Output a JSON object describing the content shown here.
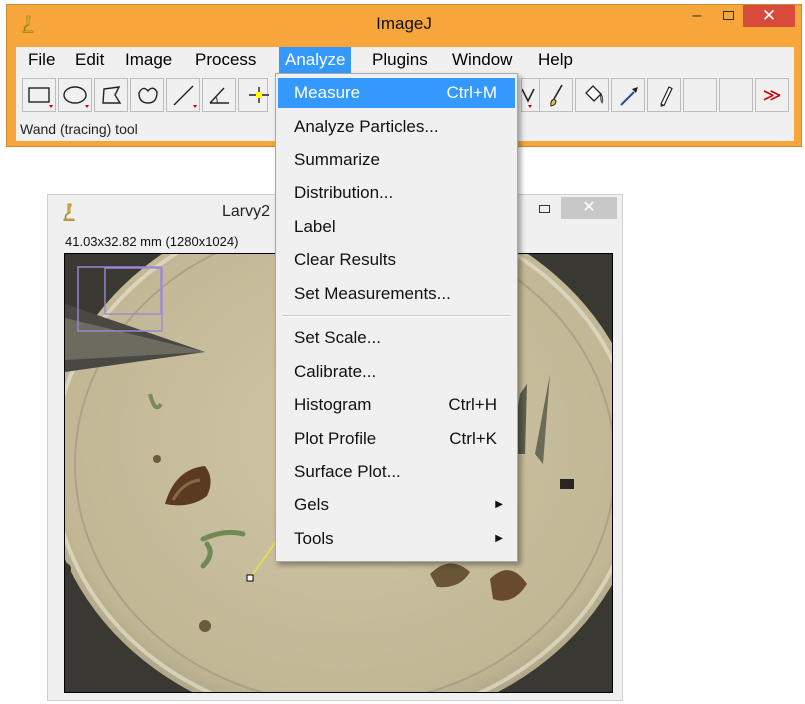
{
  "main_window": {
    "title": "ImageJ",
    "minimize_glyph": "–",
    "close_glyph": "✕",
    "menu": [
      "File",
      "Edit",
      "Image",
      "Process",
      "Analyze",
      "Plugins",
      "Window",
      "Help"
    ],
    "active_menu": "Analyze",
    "status_text": "Wand (tracing) tool",
    "toolbar_icons": [
      "rectangle-tool-icon",
      "oval-tool-icon",
      "polygon-tool-icon",
      "freehand-tool-icon",
      "line-tool-icon",
      "angle-tool-icon",
      "point-tool-icon",
      "wand-tool-icon",
      "brush-tool-icon",
      "flood-fill-tool-icon",
      "color-picker-icon",
      "pencil-tool-icon",
      "more-tools-icon"
    ],
    "more_tools_glyph": "≫",
    "accent_color": "#3399ff",
    "title_bar_color": "#f6a63a",
    "close_color": "#d74a3c"
  },
  "image_window": {
    "title": "Larvy2",
    "info": "41.03x32.82 mm (1280x1024)",
    "close_glyph": "✕"
  },
  "analyze_menu": {
    "group1": [
      {
        "label": "Measure",
        "shortcut": "Ctrl+M"
      },
      {
        "label": "Analyze Particles...",
        "shortcut": ""
      },
      {
        "label": "Summarize",
        "shortcut": ""
      },
      {
        "label": "Distribution...",
        "shortcut": ""
      },
      {
        "label": "Label",
        "shortcut": ""
      },
      {
        "label": "Clear Results",
        "shortcut": ""
      },
      {
        "label": "Set Measurements...",
        "shortcut": ""
      }
    ],
    "group2": [
      {
        "label": "Set Scale...",
        "shortcut": ""
      },
      {
        "label": "Calibrate...",
        "shortcut": ""
      },
      {
        "label": "Histogram",
        "shortcut": "Ctrl+H"
      },
      {
        "label": "Plot Profile",
        "shortcut": "Ctrl+K"
      },
      {
        "label": "Surface Plot...",
        "shortcut": ""
      },
      {
        "label": "Gels",
        "shortcut": ""
      },
      {
        "label": "Tools",
        "shortcut": ""
      }
    ],
    "highlighted": "Measure",
    "submenu_arrow": "▶"
  }
}
